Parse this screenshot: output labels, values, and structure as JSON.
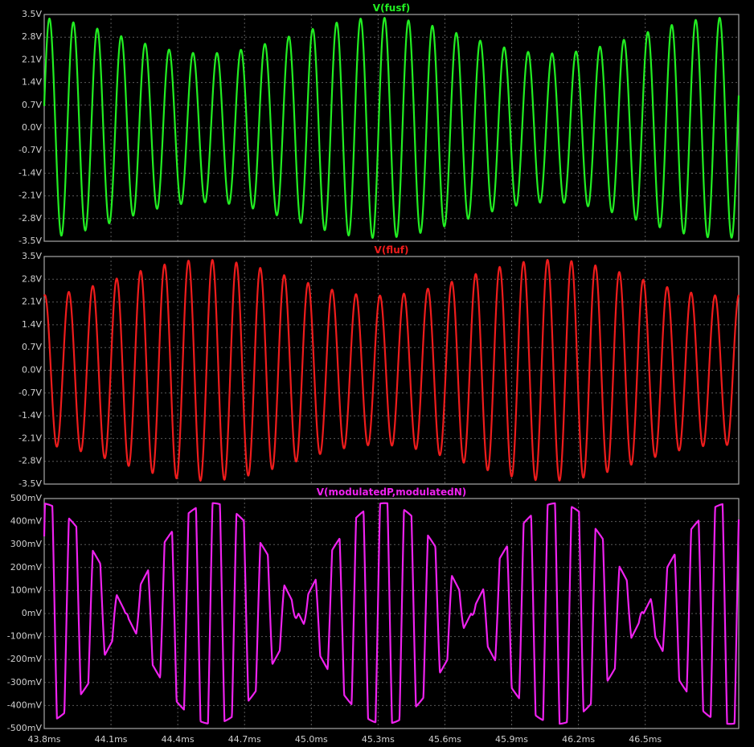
{
  "window": {
    "title": ""
  },
  "colors": {
    "background": "#000000",
    "frame": "#a8a8a8",
    "grid": "#5a5a5a",
    "tick_text": "#d0d0d0"
  },
  "chart_data": [
    {
      "type": "line",
      "title": "V(fusf)",
      "color": "#22ee22",
      "y_ticks": [
        "3.5V",
        "2.8V",
        "2.1V",
        "1.4V",
        "0.7V",
        "0.0V",
        "-0.7V",
        "-1.4V",
        "-2.1V",
        "-2.8V",
        "-3.5V"
      ],
      "ylim": [
        -3.5,
        3.5
      ],
      "xlim": [
        43.8,
        46.92
      ],
      "grid": true,
      "carrier_cycles_per_ms": 9.3,
      "amplitude_range": [
        2.3,
        3.4
      ],
      "envelope_period_ms": 1.55
    },
    {
      "type": "line",
      "title": "V(fluf)",
      "color": "#ee1c1c",
      "y_ticks": [
        "3.5V",
        "2.8V",
        "2.1V",
        "1.4V",
        "0.7V",
        "0.0V",
        "-0.7V",
        "-1.4V",
        "-2.1V",
        "-2.8V",
        "-3.5V"
      ],
      "ylim": [
        -3.5,
        3.5
      ],
      "xlim": [
        43.8,
        46.92
      ],
      "grid": true,
      "carrier_cycles_per_ms": 9.3,
      "amplitude_range": [
        2.3,
        3.4
      ],
      "envelope_period_ms": 1.55
    },
    {
      "type": "line",
      "title": "V(modulatedP,modulatedN)",
      "color": "#ee22ee",
      "y_ticks": [
        "500mV",
        "400mV",
        "300mV",
        "200mV",
        "100mV",
        "0mV",
        "-100mV",
        "-200mV",
        "-300mV",
        "-400mV",
        "-500mV"
      ],
      "ylim": [
        -500,
        500
      ],
      "xlim": [
        43.8,
        46.92
      ],
      "grid": true,
      "carrier_cycles_per_ms": 9.3,
      "amplitude_range": [
        0,
        480
      ],
      "envelope_period_ms": 0.775
    }
  ],
  "x_ticks": [
    "43.8ms",
    "44.1ms",
    "44.4ms",
    "44.7ms",
    "45.0ms",
    "45.3ms",
    "45.6ms",
    "45.9ms",
    "46.2ms",
    "46.5ms"
  ],
  "x_tick_values": [
    43.8,
    44.1,
    44.4,
    44.7,
    45.0,
    45.3,
    45.6,
    45.9,
    46.2,
    46.5
  ]
}
